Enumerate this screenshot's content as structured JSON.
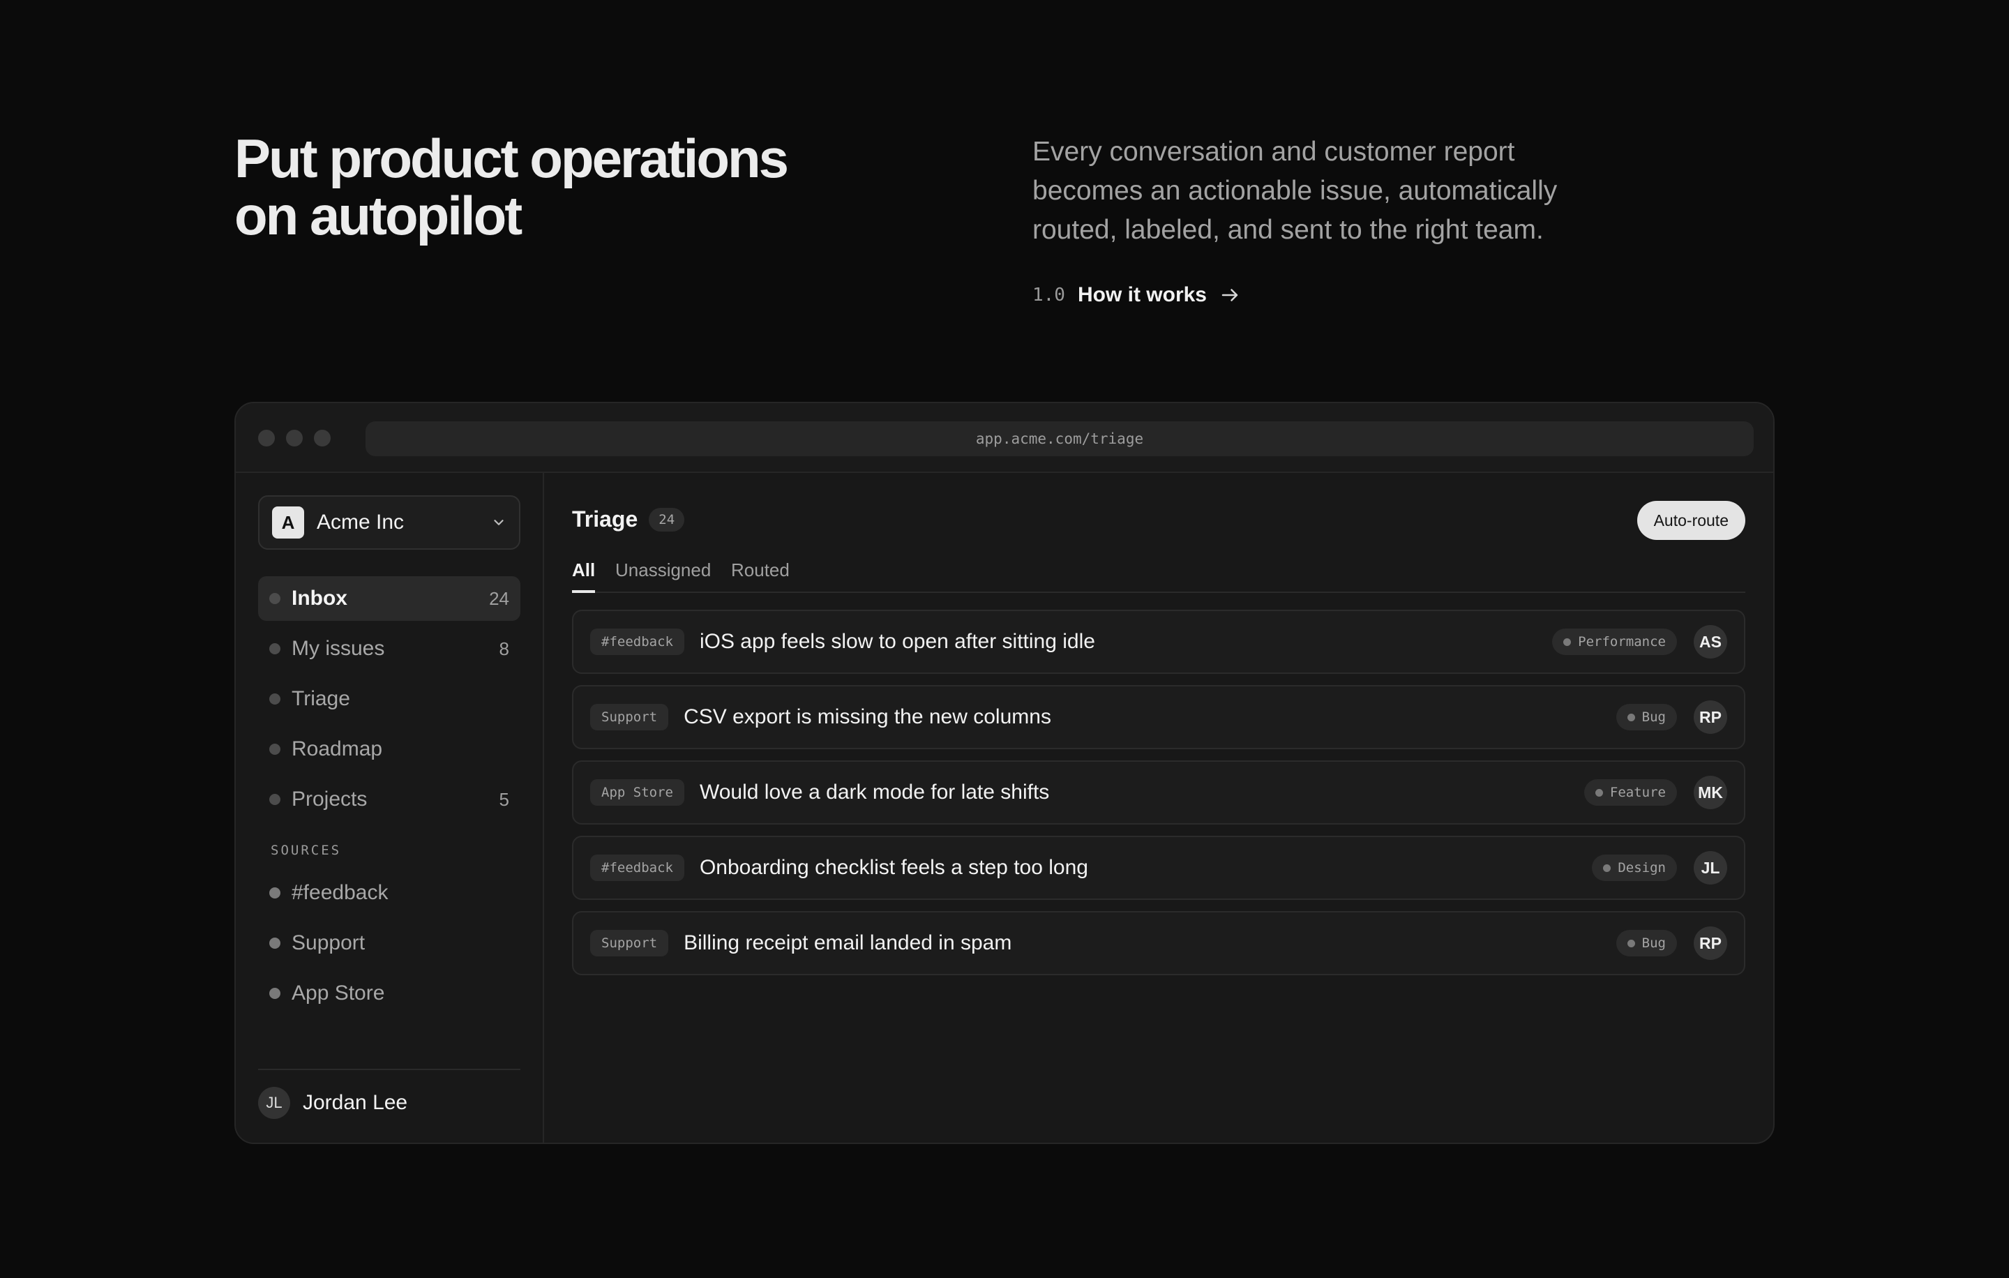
{
  "hero": {
    "title_line1": "Put product operations",
    "title_line2": "on autopilot",
    "description": "Every conversation and customer report becomes an actionable issue, automatically routed, labeled, and sent to the right team.",
    "link_number": "1.0",
    "link_label": "How it works",
    "link_icon": "arrow-right-icon"
  },
  "window": {
    "url": "app.acme.com/triage"
  },
  "sidebar": {
    "workspace": {
      "initial": "A",
      "name": "Acme Inc",
      "icon": "chevron-down-icon"
    },
    "nav": [
      {
        "label": "Inbox",
        "count": "24",
        "active": true
      },
      {
        "label": "My issues",
        "count": "8"
      },
      {
        "label": "Triage",
        "count": ""
      },
      {
        "label": "Roadmap",
        "count": ""
      },
      {
        "label": "Projects",
        "count": "5"
      }
    ],
    "sources_header": "SOURCES",
    "sources": [
      {
        "label": "#feedback"
      },
      {
        "label": "Support"
      },
      {
        "label": "App Store"
      }
    ],
    "user": {
      "initials": "JL",
      "name": "Jordan Lee"
    }
  },
  "main": {
    "title": "Triage",
    "count": "24",
    "action_label": "Auto-route",
    "tabs": [
      {
        "label": "All",
        "active": true
      },
      {
        "label": "Unassigned"
      },
      {
        "label": "Routed"
      }
    ],
    "issues": [
      {
        "source": "#feedback",
        "title": "iOS app feels slow to open after sitting idle",
        "label": "Performance",
        "assignee": "AS"
      },
      {
        "source": "Support",
        "title": "CSV export is missing the new columns",
        "label": "Bug",
        "assignee": "RP"
      },
      {
        "source": "App Store",
        "title": "Would love a dark mode for late shifts",
        "label": "Feature",
        "assignee": "MK"
      },
      {
        "source": "#feedback",
        "title": "Onboarding checklist feels a step too long",
        "label": "Design",
        "assignee": "JL"
      },
      {
        "source": "Support",
        "title": "Billing receipt email landed in spam",
        "label": "Bug",
        "assignee": "RP"
      }
    ]
  }
}
